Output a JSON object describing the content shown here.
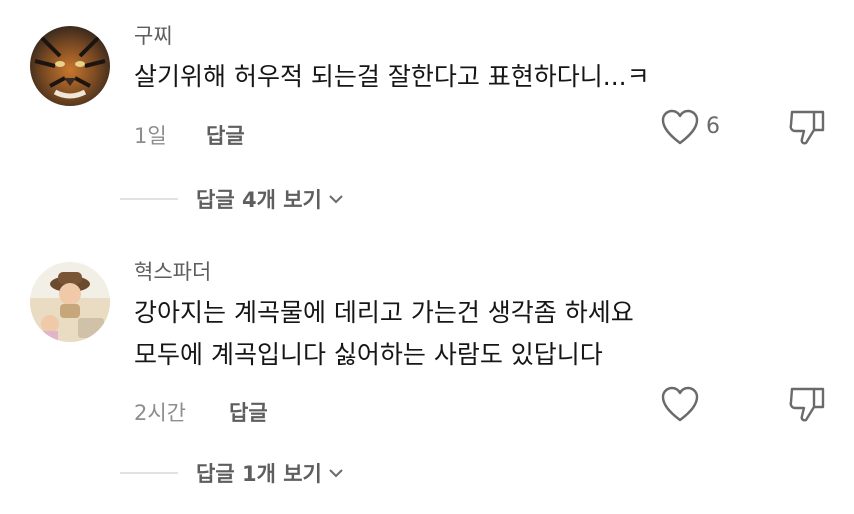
{
  "comments": [
    {
      "username": "구찌",
      "lines": [
        "살기위해 허우적 되는걸 잘한다고 표현하다니...ㅋ"
      ],
      "time": "1일",
      "reply_label": "답글",
      "like_count": "6",
      "view_replies": "답글 4개 보기",
      "avatar_icon": "tiger-avatar"
    },
    {
      "username": "혁스파더",
      "lines": [
        "강아지는 계곡물에 데리고 가는건 생각좀 하세요",
        "모두에 계곡입니다 싫어하는 사람도 있답니다"
      ],
      "time": "2시간",
      "reply_label": "답글",
      "like_count": "",
      "view_replies": "답글 1개 보기",
      "avatar_icon": "child-photo-avatar"
    }
  ],
  "icons": {
    "like": "heart-outline-icon",
    "dislike": "thumbs-down-outline-icon",
    "expand": "chevron-down-icon"
  }
}
